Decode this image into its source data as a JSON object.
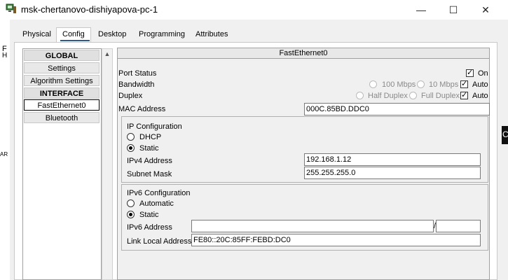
{
  "window": {
    "title": "msk-chertanovo-dishiyapova-pc-1",
    "controls": {
      "minimize": "—",
      "maximize": "☐",
      "close": "✕"
    }
  },
  "tabs": [
    {
      "label": "Physical"
    },
    {
      "label": "Config"
    },
    {
      "label": "Desktop"
    },
    {
      "label": "Programming"
    },
    {
      "label": "Attributes"
    }
  ],
  "active_tab": "Config",
  "sidebar": {
    "items": [
      {
        "label": "GLOBAL",
        "type": "header"
      },
      {
        "label": "Settings",
        "type": "item"
      },
      {
        "label": "Algorithm Settings",
        "type": "item"
      },
      {
        "label": "INTERFACE",
        "type": "header"
      },
      {
        "label": "FastEthernet0",
        "type": "item",
        "selected": true
      },
      {
        "label": "Bluetooth",
        "type": "item"
      }
    ]
  },
  "interface": {
    "title": "FastEthernet0",
    "port_status": {
      "label": "Port Status",
      "checkbox_label": "On",
      "checked": true
    },
    "bandwidth": {
      "label": "Bandwidth",
      "options": [
        "100 Mbps",
        "10 Mbps"
      ],
      "auto_label": "Auto",
      "auto_checked": true
    },
    "duplex": {
      "label": "Duplex",
      "options": [
        "Half Duplex",
        "Full Duplex"
      ],
      "auto_label": "Auto",
      "auto_checked": true
    },
    "mac": {
      "label": "MAC Address",
      "value": "000C.85BD.DDC0"
    }
  },
  "ipv4": {
    "title": "IP Configuration",
    "dhcp_label": "DHCP",
    "static_label": "Static",
    "mode": "Static",
    "address_label": "IPv4 Address",
    "address": "192.168.1.12",
    "mask_label": "Subnet Mask",
    "mask": "255.255.255.0"
  },
  "ipv6": {
    "title": "IPv6 Configuration",
    "automatic_label": "Automatic",
    "static_label": "Static",
    "mode": "Static",
    "address_label": "IPv6 Address",
    "address": "",
    "prefix_separator": "/",
    "prefix": "",
    "link_local_label": "Link Local Address",
    "link_local": "FE80::20C:85FF:FEBD:DC0"
  },
  "background": {
    "left_edge_texts": [
      "F",
      "H",
      "AR"
    ],
    "right_edge_text": "C"
  },
  "colors": {
    "tab_underline": "#2b5a8c",
    "panel_bg": "#f0f0f0"
  }
}
